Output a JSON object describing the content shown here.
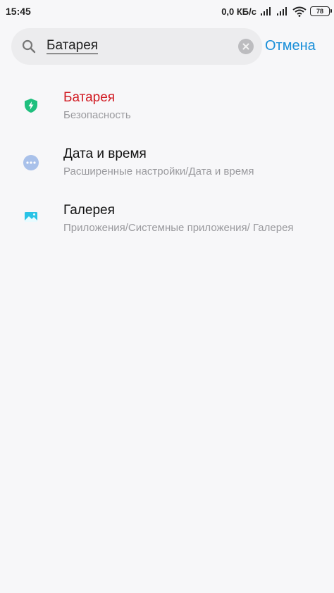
{
  "status_bar": {
    "time": "15:45",
    "net_speed": "0,0 КБ/с",
    "battery_level": "78"
  },
  "search": {
    "query": "Батарея",
    "cancel_label": "Отмена"
  },
  "results": [
    {
      "title": "Батарея",
      "subtitle": "Безопасность",
      "icon": "shield-bolt-icon",
      "title_color": "#d11a22"
    },
    {
      "title": "Дата и время",
      "subtitle": "Расширенные настройки/Дата и время",
      "icon": "more-dots-icon"
    },
    {
      "title": "Галерея",
      "subtitle": "Приложения/Системные приложения/ Галерея",
      "icon": "gallery-icon"
    }
  ],
  "colors": {
    "accent": "#1a8fd9",
    "highlight": "#d11a22",
    "background": "#f7f7f9"
  }
}
